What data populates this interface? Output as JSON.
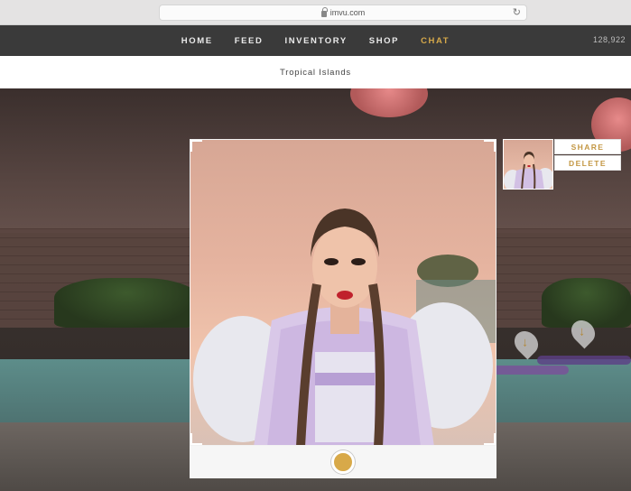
{
  "browser": {
    "url": "imvu.com",
    "lock_icon": "lock-icon",
    "reload_icon": "reload-icon"
  },
  "nav": {
    "items": [
      {
        "label": "HOME"
      },
      {
        "label": "FEED"
      },
      {
        "label": "INVENTORY"
      },
      {
        "label": "SHOP"
      },
      {
        "label": "CHAT",
        "active": true
      }
    ],
    "count": "128,922",
    "accent_color": "#d6a94a"
  },
  "room": {
    "title": "Tropical Islands"
  },
  "snapshot": {
    "share_label": "SHARE",
    "delete_label": "DELETE"
  },
  "camera": {
    "shutter_color": "#d8a949"
  }
}
